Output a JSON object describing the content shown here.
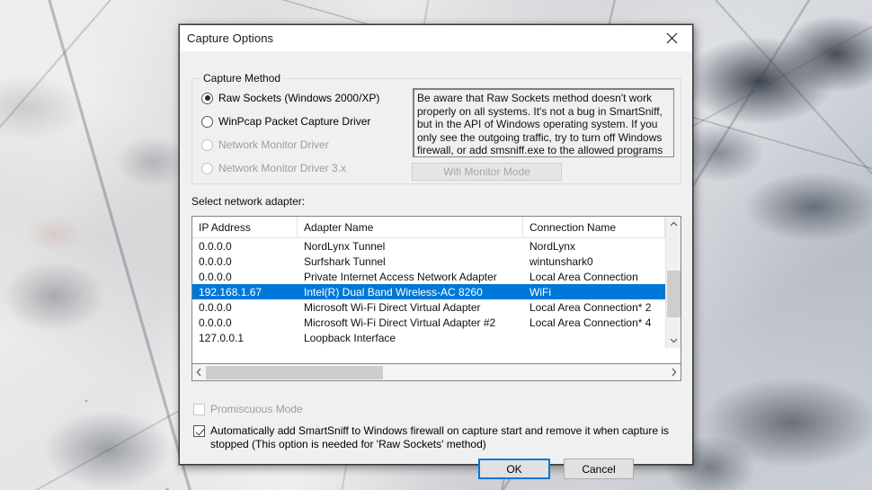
{
  "window": {
    "title": "Capture Options",
    "close_icon": "close-icon"
  },
  "capture_method": {
    "legend": "Capture Method",
    "options": [
      {
        "label": "Raw Sockets (Windows 2000/XP)",
        "checked": true,
        "disabled": false
      },
      {
        "label": "WinPcap Packet Capture Driver",
        "checked": false,
        "disabled": false
      },
      {
        "label": "Network Monitor Driver",
        "checked": false,
        "disabled": true
      },
      {
        "label": "Network Monitor Driver 3.x",
        "checked": false,
        "disabled": true
      }
    ],
    "info_text": "Be aware that Raw Sockets method doesn't work properly on all systems. It's not a bug in SmartSniff, but in the API of Windows operating system. If you only see the outgoing traffic, try to turn off Windows firewall, or add smsniff.exe to the allowed programs list of Windows firewall.",
    "wifi_monitor_button": "Wifi Monitor Mode"
  },
  "adapter_section": {
    "label": "Select network adapter:",
    "columns": [
      "IP Address",
      "Adapter Name",
      "Connection Name"
    ],
    "rows": [
      {
        "ip": "0.0.0.0",
        "adapter": "NordLynx Tunnel",
        "connection": "NordLynx",
        "selected": false
      },
      {
        "ip": "0.0.0.0",
        "adapter": "Surfshark Tunnel",
        "connection": "wintunshark0",
        "selected": false
      },
      {
        "ip": "0.0.0.0",
        "adapter": "Private Internet Access Network Adapter",
        "connection": "Local Area Connection",
        "selected": false
      },
      {
        "ip": "192.168.1.67",
        "adapter": "Intel(R) Dual Band Wireless-AC 8260",
        "connection": "WiFi",
        "selected": true
      },
      {
        "ip": "0.0.0.0",
        "adapter": "Microsoft Wi-Fi Direct Virtual Adapter",
        "connection": "Local Area Connection* 2",
        "selected": false
      },
      {
        "ip": "0.0.0.0",
        "adapter": "Microsoft Wi-Fi Direct Virtual Adapter #2",
        "connection": "Local Area Connection* 4",
        "selected": false
      },
      {
        "ip": "127.0.0.1",
        "adapter": "Loopback Interface",
        "connection": "",
        "selected": false
      }
    ],
    "scroll_up_icon": "chevron-up-icon",
    "scroll_down_icon": "chevron-down-icon",
    "scroll_left_icon": "chevron-left-icon",
    "scroll_right_icon": "chevron-right-icon"
  },
  "options": {
    "promiscuous_label": "Promiscuous Mode",
    "promiscuous_checked": false,
    "promiscuous_disabled": true,
    "auto_firewall_label": "Automatically add SmartSniff to Windows firewall on capture start and remove it when capture is stopped (This option is needed for 'Raw Sockets' method)",
    "auto_firewall_checked": true
  },
  "buttons": {
    "ok": "OK",
    "cancel": "Cancel"
  },
  "colors": {
    "selection_blue": "#0078d7",
    "dialog_bg": "#f0f0f0",
    "disabled_text": "#9d9d9d"
  }
}
